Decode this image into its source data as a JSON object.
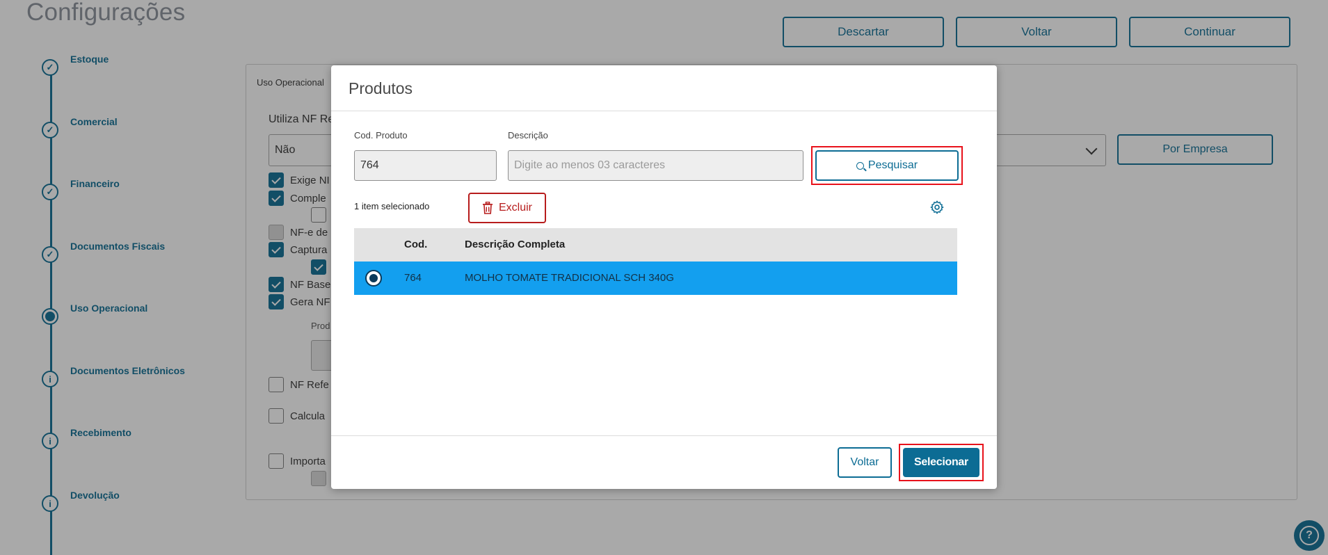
{
  "page": {
    "title": "Configurações",
    "actions": {
      "discard": "Descartar",
      "back": "Voltar",
      "continue": "Continuar"
    }
  },
  "stepper": {
    "steps": [
      {
        "label": "Estoque",
        "status": "done",
        "icon": "check-icon"
      },
      {
        "label": "Comercial",
        "status": "done",
        "icon": "check-icon"
      },
      {
        "label": "Financeiro",
        "status": "done",
        "icon": "check-icon"
      },
      {
        "label": "Documentos Fiscais",
        "status": "done",
        "icon": "check-icon"
      },
      {
        "label": "Uso Operacional",
        "status": "current",
        "icon": "current-dot-icon"
      },
      {
        "label": "Documentos Eletrônicos",
        "status": "pending",
        "icon": "info-icon"
      },
      {
        "label": "Recebimento",
        "status": "pending",
        "icon": "info-icon"
      },
      {
        "label": "Devolução",
        "status": "pending",
        "icon": "info-icon"
      }
    ]
  },
  "content": {
    "section_title": "Uso Operacional",
    "field_label": "Utiliza NF Re",
    "select_value": "Não",
    "por_empresa": "Por Empresa",
    "checkboxes": [
      {
        "label": "Exige NI",
        "checked": true
      },
      {
        "label": "Comple",
        "checked": true
      },
      {
        "label": "",
        "checked": false
      },
      {
        "label": "NF-e de",
        "checked": false,
        "disabled": true
      },
      {
        "label": "Captura",
        "checked": true
      },
      {
        "label": "",
        "checked": true
      },
      {
        "label": "NF Base",
        "checked": true
      },
      {
        "label": "Gera NF",
        "checked": true
      },
      {
        "label": "NF Refe",
        "checked": false
      },
      {
        "label": "Calcula",
        "checked": false
      },
      {
        "label": "Importa",
        "checked": false
      },
      {
        "label": "",
        "checked": false,
        "disabled": true
      }
    ],
    "prod_label": "Prod"
  },
  "modal": {
    "title": "Produtos",
    "cod_label": "Cod. Produto",
    "cod_value": "764",
    "desc_label": "Descrição",
    "desc_placeholder": "Digite ao menos 03 caracteres",
    "search_label": "Pesquisar",
    "selected_count": "1 item selecionado",
    "delete_label": "Excluir",
    "table": {
      "columns": [
        "Cod.",
        "Descrição Completa"
      ],
      "rows": [
        {
          "cod": "764",
          "desc": "MOLHO TOMATE TRADICIONAL SCH 340G",
          "selected": true
        }
      ]
    },
    "back_label": "Voltar",
    "select_label": "Selecionar"
  },
  "colors": {
    "primary": "#0c6c94",
    "selected_row": "#139fef",
    "danger": "#b71c1c",
    "highlight": "#e8121b"
  }
}
